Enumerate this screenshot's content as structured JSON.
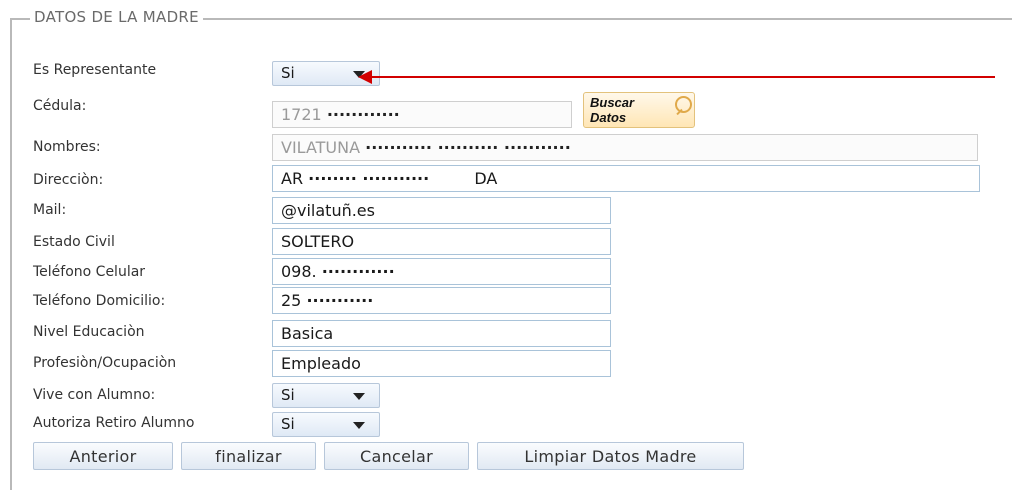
{
  "section": {
    "title": "DATOS DE LA MADRE"
  },
  "labels": {
    "representante": "Es Representante",
    "cedula": "Cédula:",
    "nombres": "Nombres:",
    "direccion": "Direcciòn:",
    "mail": "Mail:",
    "estado_civil": "Estado Civil",
    "telefono_celular": "Teléfono Celular",
    "telefono_domicilio": "Teléfono Domicilio:",
    "nivel_educacion": "Nivel Educaciòn",
    "profesion": "Profesiòn/Ocupaciòn",
    "vive_con_alumno": "Vive con Alumno:",
    "autoriza_retiro": "Autoriza Retiro Alumno"
  },
  "values": {
    "representante": "Si",
    "cedula": "1721",
    "cedula_mask": "············",
    "nombres": "VILATUNA",
    "nombres_mask": "··········· ··········   ···········",
    "direccion_a": "AR",
    "direccion_mask": "········ ···········",
    "direccion_b": "DA",
    "mail": "@vilatuñ.es",
    "estado_civil": "SOLTERO",
    "telefono_celular": "098.",
    "telefono_celular_mask": "············",
    "telefono_domicilio": "25",
    "telefono_domicilio_mask": "···········",
    "nivel_educacion": "Basica",
    "profesion": "Empleado",
    "vive_con_alumno": "Si",
    "autoriza_retiro": "Si"
  },
  "buttons": {
    "buscar": "Buscar Datos",
    "anterior": "Anterior",
    "finalizar": "finalizar",
    "cancelar": "Cancelar",
    "limpiar": "Limpiar Datos Madre"
  },
  "icons": {
    "buscar": "magnifier-icon",
    "dropdown": "chevron-down-icon",
    "annotation": "red-arrow-annotation"
  },
  "colors": {
    "annotation_arrow": "#d20000",
    "section_border": "#b9b9b9",
    "input_border": "#a9c3d9",
    "search_button_bg": "#ffe6b5"
  }
}
